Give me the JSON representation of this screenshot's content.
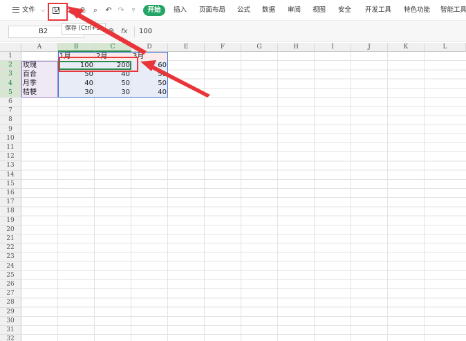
{
  "toolbar": {
    "menu_icon": "hamburger-menu-icon",
    "file_label": "文件",
    "tabs": [
      "开始",
      "插入",
      "页面布局",
      "公式",
      "数据",
      "审阅",
      "视图",
      "安全",
      "开发工具",
      "特色功能",
      "智能工具"
    ],
    "active_tab_color": "#22a565"
  },
  "tooltip": {
    "text": "保存 (Ctrl+S)"
  },
  "formula_bar": {
    "cell_ref": "B2",
    "fx_label": "fx",
    "value": "100"
  },
  "columns": [
    "A",
    "B",
    "C",
    "D",
    "E",
    "F",
    "G",
    "H",
    "I",
    "J",
    "K",
    "L"
  ],
  "rows": [
    "1",
    "2",
    "3",
    "4",
    "5",
    "6",
    "7",
    "8",
    "9",
    "10",
    "11",
    "12",
    "13",
    "14",
    "15",
    "16",
    "17",
    "18",
    "19",
    "20",
    "21",
    "22",
    "23",
    "24",
    "25",
    "26",
    "27",
    "28",
    "29",
    "30",
    "31",
    "32"
  ],
  "sheet": {
    "headers": {
      "B1": "1月",
      "C1": "2月",
      "D1": "3月"
    },
    "rows": [
      {
        "name": "玫瑰",
        "b": "100",
        "c": "200",
        "d": "60"
      },
      {
        "name": "百合",
        "b": "50",
        "c": "40",
        "d": "50"
      },
      {
        "name": "月季",
        "b": "40",
        "c": "50",
        "d": "50"
      },
      {
        "name": "桔梗",
        "b": "30",
        "c": "30",
        "d": "40"
      }
    ]
  },
  "annotation_color": "#e8353a"
}
